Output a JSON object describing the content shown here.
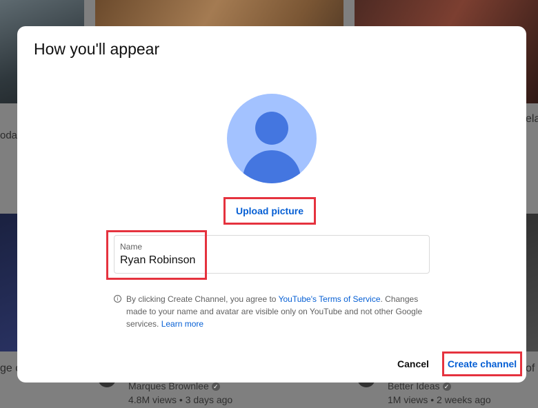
{
  "background": {
    "left_snippet_1": "oday",
    "right_snippet_1": "ela",
    "left_snippet_2": "ge c",
    "right_snippet_2": "of",
    "video_2": {
      "channel": "Marques Brownlee",
      "meta": "4.8M views • 3 days ago"
    },
    "video_3": {
      "channel": "Better Ideas",
      "meta": "1M views • 2 weeks ago"
    }
  },
  "dialog": {
    "title": "How you'll appear",
    "upload_label": "Upload picture",
    "name_field": {
      "label": "Name",
      "value": "Ryan Robinson"
    },
    "terms": {
      "part1": "By clicking Create Channel, you agree to ",
      "tos_link": "YouTube's Terms of Service",
      "part2": ". Changes made to your name and avatar are visible only on YouTube and not other Google services. ",
      "learn_more": "Learn more"
    },
    "cancel_label": "Cancel",
    "create_label": "Create channel"
  },
  "colors": {
    "link": "#065fd4",
    "highlight": "#e5323e",
    "avatar_bg": "#a3c2ff",
    "avatar_fg": "#4476e0"
  }
}
